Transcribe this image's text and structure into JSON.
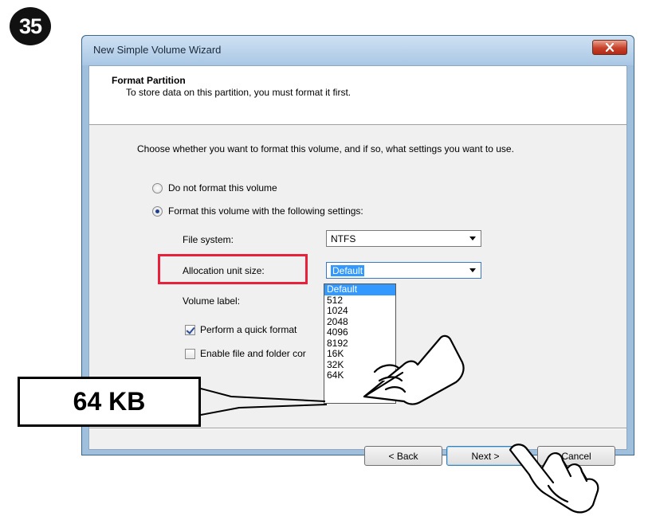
{
  "step_number": "35",
  "window": {
    "title": "New Simple Volume Wizard"
  },
  "header": {
    "title": "Format Partition",
    "subtitle": "To store data on this partition, you must format it first."
  },
  "instruction": "Choose whether you want to format this volume, and if so, what settings you want to use.",
  "options": {
    "no_format": {
      "label": "Do not format this volume",
      "selected": false
    },
    "format": {
      "label": "Format this volume with the following settings:",
      "selected": true
    }
  },
  "fields": {
    "file_system": {
      "label": "File system:",
      "value": "NTFS"
    },
    "allocation_unit_size": {
      "label": "Allocation unit size:",
      "value": "Default"
    },
    "volume_label": {
      "label": "Volume label:"
    }
  },
  "allocation_options": [
    "Default",
    "512",
    "1024",
    "2048",
    "4096",
    "8192",
    "16K",
    "32K",
    "64K"
  ],
  "checkboxes": {
    "quick_format": {
      "label": "Perform a quick format",
      "checked": true
    },
    "compression": {
      "label": "Enable file and folder cor",
      "checked": false
    }
  },
  "buttons": {
    "back": "< Back",
    "next": "Next >",
    "cancel": "Cancel"
  },
  "callout": "64 KB",
  "colors": {
    "highlight": "#e8203c",
    "selection": "#3399ff",
    "titlebar": "#a9c7e5"
  },
  "icons": [
    "close-icon",
    "pointing-hand-icon"
  ]
}
